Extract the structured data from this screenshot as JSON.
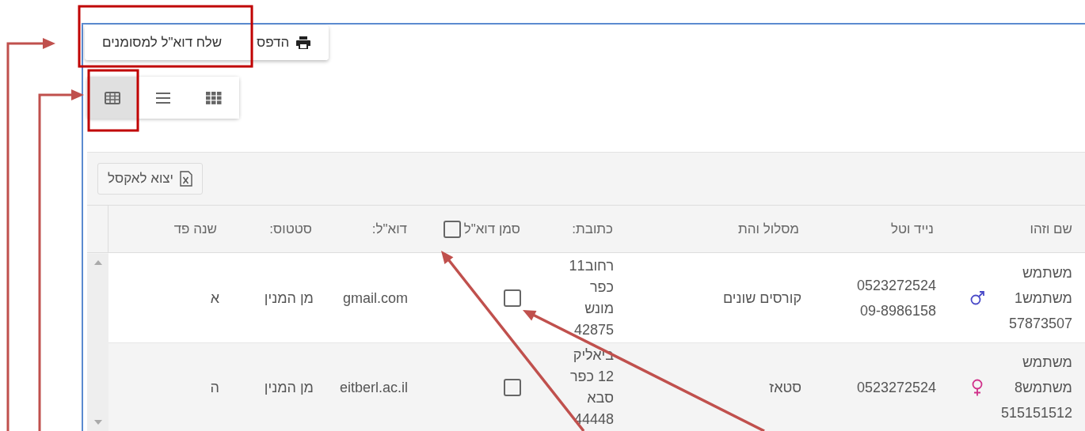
{
  "actions": [
    {
      "label": "הדפס",
      "kind": "print"
    },
    {
      "label": "שלח דוא\"ל למסומנים",
      "kind": "send"
    }
  ],
  "views": [
    {
      "kind": "table",
      "selected": true
    },
    {
      "kind": "list",
      "selected": false
    },
    {
      "kind": "grid",
      "selected": false
    }
  ],
  "export_button": "יצוא לאקסל",
  "table": {
    "columns": [
      "שם וזהו",
      "נייד וטל",
      "מסלול והת",
      "כתובת:",
      "סמן דוא\"ל",
      "דוא\"ל:",
      "סטטוס:",
      "שנה פד"
    ],
    "mark_all_checked": false,
    "rows": [
      {
        "name": "משתמש משתמש1 57873507",
        "kind": "male",
        "phones": [
          "0523272524",
          "09-8986158"
        ],
        "track": "קורסים שונים",
        "address": "רחוב11 כפר מונש 42875",
        "checked": false,
        "email": "gmail.com",
        "status": "מן המנין",
        "year": "א"
      },
      {
        "name": "משתמש משתמש8 515151512",
        "kind": "female",
        "phones": [
          "0523272524"
        ],
        "track": "סטאז",
        "address": "ביאליק 12 כפר סבא 44448",
        "checked": false,
        "email": "eitberl.ac.il",
        "status": "מן המנין",
        "year": "ה"
      }
    ]
  }
}
